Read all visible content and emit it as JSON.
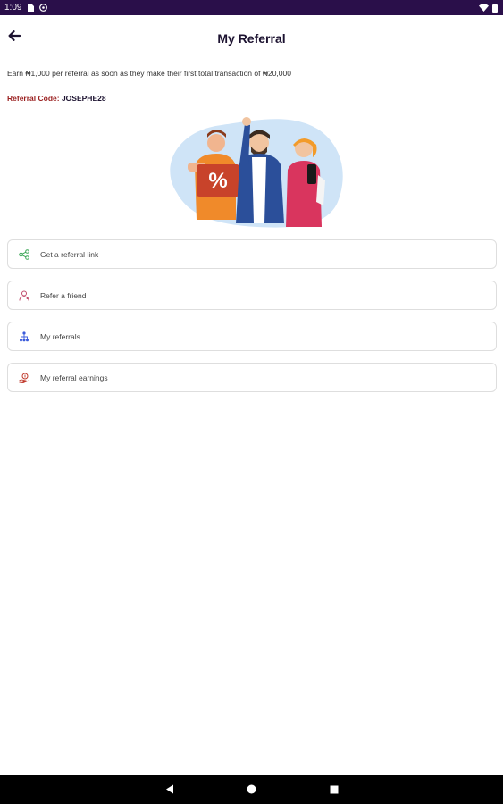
{
  "status_bar": {
    "time": "1:09",
    "icons": [
      "sim-card-icon",
      "at-sign-icon",
      "wifi-icon",
      "battery-icon"
    ]
  },
  "header": {
    "title": "My Referral",
    "back_icon": "arrow-left-icon"
  },
  "intro": {
    "text": "Earn ₦1,000  per referral as soon as they make their first total transaction of ₦20,000"
  },
  "referral": {
    "label": "Referral Code:",
    "code": "JOSEPHE28"
  },
  "menu": {
    "items": [
      {
        "label": "Get a referral link",
        "icon": "share-icon",
        "color": "#3aa655"
      },
      {
        "label": "Refer a friend",
        "icon": "user-icon",
        "color": "#c04a6a"
      },
      {
        "label": "My referrals",
        "icon": "referral-tree-icon",
        "color": "#3b5bdb"
      },
      {
        "label": "My referral earnings",
        "icon": "money-hand-icon",
        "color": "#c0392b"
      }
    ]
  },
  "nav_bar": {
    "icons": [
      "back-triangle-icon",
      "home-circle-icon",
      "recents-square-icon"
    ]
  },
  "colors": {
    "status_bar": "#2a0f4a",
    "title": "#1c1230",
    "referral_label": "#9a1f1f"
  }
}
